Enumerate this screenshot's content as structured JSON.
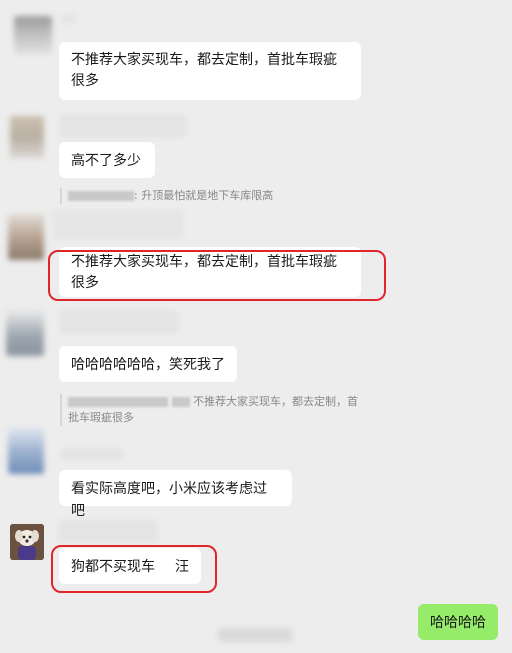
{
  "messages": [
    {
      "text": "不推荐大家买现车，都去定制，首批车瑕疵很多"
    },
    {
      "text": "高不了多少"
    },
    {
      "text": "不推荐大家买现车，都去定制，首批车瑕疵很多"
    },
    {
      "text": "哈哈哈哈哈哈，笑死我了"
    },
    {
      "text": "看实际高度吧，小米应该考虑过吧"
    },
    {
      "text": "狗都不买现车",
      "suffix": "汪"
    },
    {
      "text": "哈哈哈哈"
    }
  ],
  "quotes": [
    {
      "text": ": 升顶最怕就是地下车库限高"
    },
    {
      "text": "不推荐大家买现车，都去定制，首批车瑕疵很多"
    }
  ],
  "colors": {
    "background": "#ededed",
    "bubble_other": "#ffffff",
    "bubble_self": "#95ec69",
    "highlight_box": "#e0262d"
  }
}
